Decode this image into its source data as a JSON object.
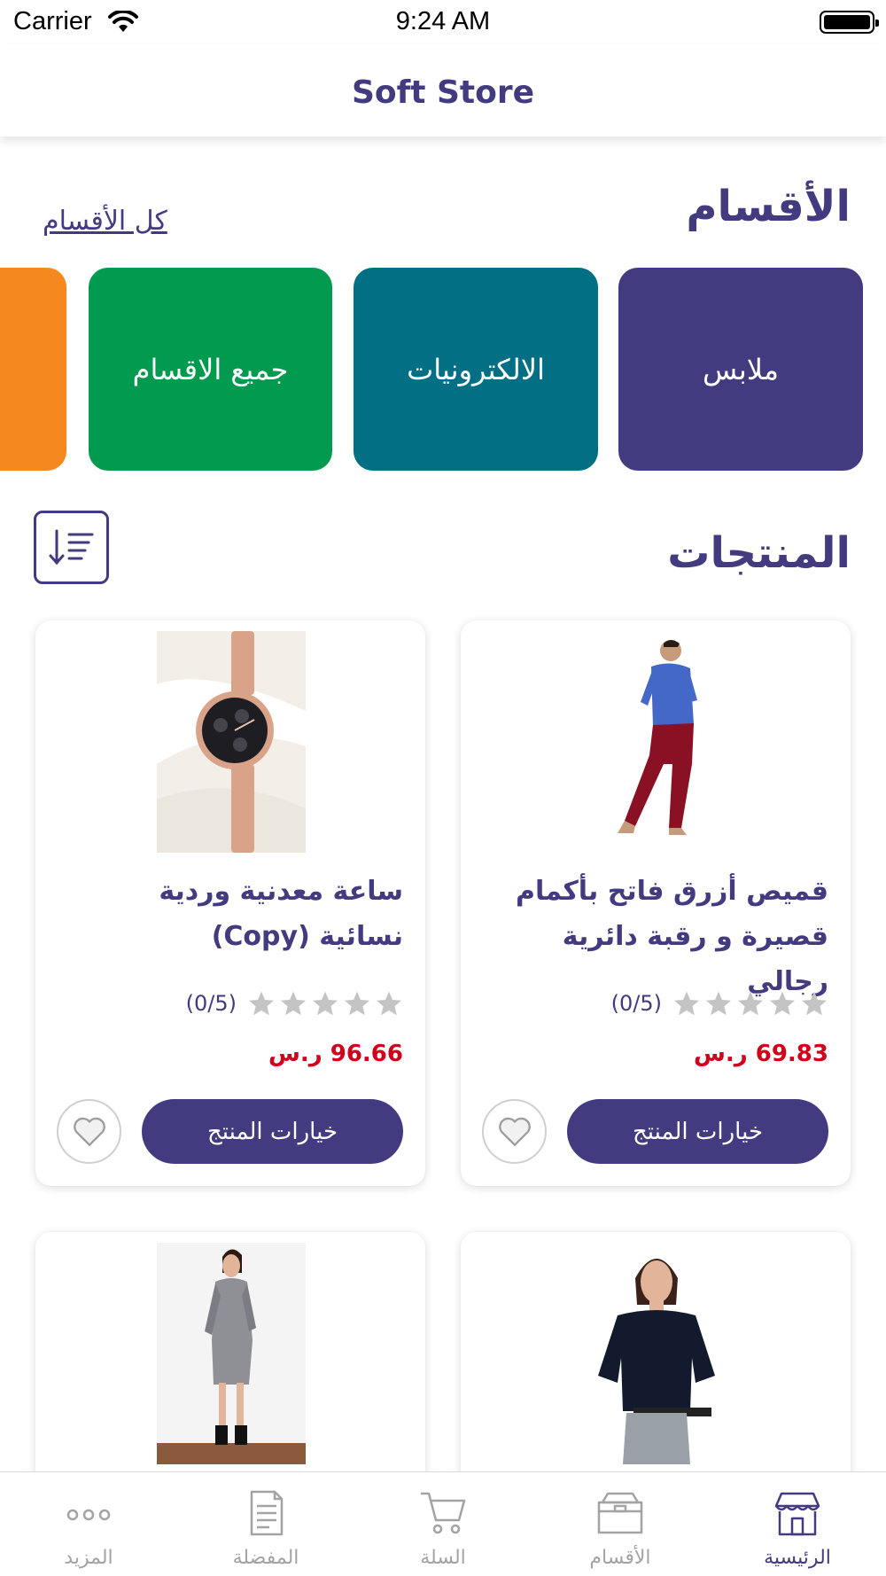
{
  "status_bar": {
    "carrier": "Carrier",
    "time": "9:24 AM"
  },
  "nav": {
    "title": "Soft Store"
  },
  "categories_section": {
    "title": "الأقسام",
    "see_all": "كل الأقسام",
    "tiles": [
      {
        "label": "ملابس",
        "color": "#433b80"
      },
      {
        "label": "الالكترونيات",
        "color": "#036f84"
      },
      {
        "label": "جميع الاقسام",
        "color": "#029a4f"
      },
      {
        "label": "",
        "color": "#f5891f"
      }
    ]
  },
  "products_section": {
    "title": "المنتجات",
    "sort_icon": "sort-descending-icon",
    "products": [
      {
        "title": "قميص أزرق فاتح بأكمام قصيرة و رقبة دائرية رجالي",
        "rating": "(0/5)",
        "stars": 0,
        "price": "69.83 ر.س",
        "button": "خيارات المنتج"
      },
      {
        "title": "ساعة معدنية وردية نسائية (Copy)",
        "rating": "(0/5)",
        "stars": 0,
        "price": "96.66 ر.س",
        "button": "خيارات المنتج"
      },
      {
        "title": ""
      },
      {
        "title": ""
      }
    ]
  },
  "tab_bar": {
    "tabs": [
      {
        "label": "الرئيسية",
        "icon": "store-icon",
        "active": true
      },
      {
        "label": "الأقسام",
        "icon": "box-icon",
        "active": false
      },
      {
        "label": "السلة",
        "icon": "cart-icon",
        "active": false
      },
      {
        "label": "المفضلة",
        "icon": "document-icon",
        "active": false
      },
      {
        "label": "المزيد",
        "icon": "more-icon",
        "active": false
      }
    ]
  },
  "colors": {
    "primary": "#433b80",
    "price": "#d0021b",
    "star_empty": "#c4c4c4",
    "tab_inactive": "#a3a3a3"
  }
}
